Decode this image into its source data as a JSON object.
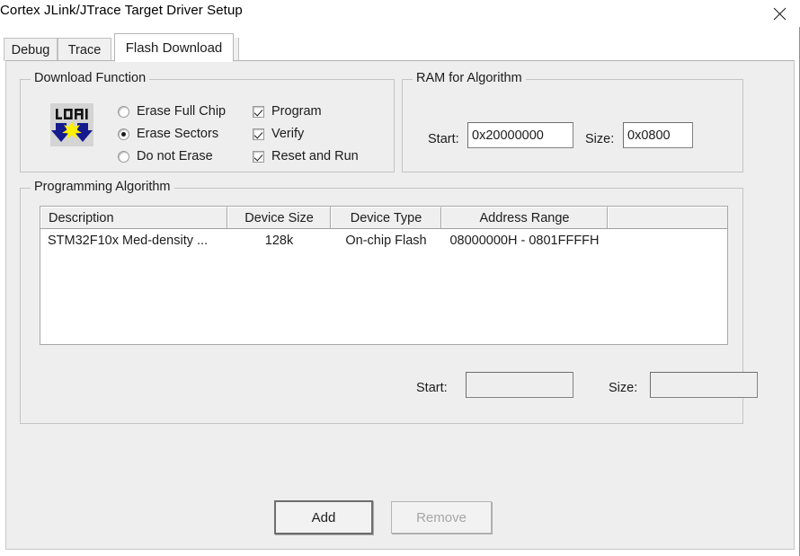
{
  "window": {
    "title": "Cortex JLink/JTrace Target Driver Setup",
    "close_label": "close-icon"
  },
  "tabs": [
    {
      "label": "Debug",
      "active": false
    },
    {
      "label": "Trace",
      "active": false
    },
    {
      "label": "Flash Download",
      "active": true
    }
  ],
  "download_function": {
    "title": "Download Function",
    "icon_label": "LOAD",
    "radios": [
      {
        "label": "Erase Full Chip",
        "checked": false
      },
      {
        "label": "Erase Sectors",
        "checked": true
      },
      {
        "label": "Do not Erase",
        "checked": false
      }
    ],
    "checkboxes": [
      {
        "label": "Program",
        "checked": true
      },
      {
        "label": "Verify",
        "checked": true
      },
      {
        "label": "Reset and Run",
        "checked": true
      }
    ]
  },
  "ram_for_algorithm": {
    "title": "RAM for Algorithm",
    "start_label": "Start:",
    "start_value": "0x20000000",
    "size_label": "Size:",
    "size_value": "0x0800"
  },
  "programming_algorithm": {
    "title": "Programming Algorithm",
    "columns": [
      "Description",
      "Device Size",
      "Device Type",
      "Address Range",
      ""
    ],
    "rows": [
      {
        "description": "STM32F10x Med-density ...",
        "device_size": "128k",
        "device_type": "On-chip Flash",
        "address_range": "08000000H - 0801FFFFH",
        "extra": ""
      }
    ],
    "start_label": "Start:",
    "start_value": "",
    "size_label": "Size:",
    "size_value": ""
  },
  "buttons": {
    "add": "Add",
    "remove": "Remove"
  },
  "colors": {
    "dialog_background": "#eeeeee",
    "window_background": "#ffffff",
    "icon_arrow": "#151b8d",
    "icon_star": "#ffef00",
    "text": "#1c1c1c",
    "disabled_text": "#a6a6a6"
  }
}
